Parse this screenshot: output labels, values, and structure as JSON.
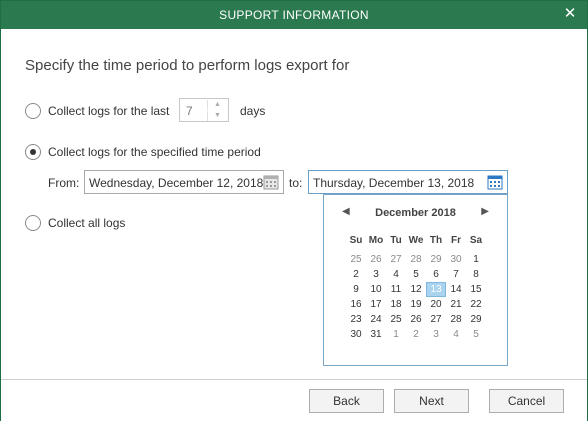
{
  "window": {
    "title": "SUPPORT INFORMATION",
    "close_glyph": "✕"
  },
  "heading": "Specify the time period to perform logs export for",
  "options": {
    "last_days": {
      "label": "Collect logs for the last",
      "value": "7",
      "unit": "days",
      "selected": false
    },
    "period": {
      "label": "Collect logs for the specified time period",
      "selected": true
    },
    "all": {
      "label": "Collect all logs",
      "selected": false
    }
  },
  "period": {
    "from_label": "From:",
    "from_value": "Wednesday, December 12, 2018",
    "to_label": "to:",
    "to_value": "Thursday, December 13, 2018"
  },
  "calendar": {
    "month": "December 2018",
    "prev": "◀",
    "next": "▶",
    "weekdays": [
      "Su",
      "Mo",
      "Tu",
      "We",
      "Th",
      "Fr",
      "Sa"
    ],
    "weeks": [
      [
        {
          "d": "25",
          "o": true
        },
        {
          "d": "26",
          "o": true
        },
        {
          "d": "27",
          "o": true
        },
        {
          "d": "28",
          "o": true
        },
        {
          "d": "29",
          "o": true
        },
        {
          "d": "30",
          "o": true
        },
        {
          "d": "1"
        }
      ],
      [
        {
          "d": "2"
        },
        {
          "d": "3"
        },
        {
          "d": "4"
        },
        {
          "d": "5"
        },
        {
          "d": "6"
        },
        {
          "d": "7"
        },
        {
          "d": "8"
        }
      ],
      [
        {
          "d": "9"
        },
        {
          "d": "10"
        },
        {
          "d": "11"
        },
        {
          "d": "12"
        },
        {
          "d": "13",
          "s": true
        },
        {
          "d": "14"
        },
        {
          "d": "15"
        }
      ],
      [
        {
          "d": "16"
        },
        {
          "d": "17"
        },
        {
          "d": "18"
        },
        {
          "d": "19"
        },
        {
          "d": "20"
        },
        {
          "d": "21"
        },
        {
          "d": "22"
        }
      ],
      [
        {
          "d": "23"
        },
        {
          "d": "24"
        },
        {
          "d": "25"
        },
        {
          "d": "26"
        },
        {
          "d": "27"
        },
        {
          "d": "28"
        },
        {
          "d": "29"
        }
      ],
      [
        {
          "d": "30"
        },
        {
          "d": "31"
        },
        {
          "d": "1",
          "o": true
        },
        {
          "d": "2",
          "o": true
        },
        {
          "d": "3",
          "o": true
        },
        {
          "d": "4",
          "o": true
        },
        {
          "d": "5",
          "o": true
        }
      ]
    ]
  },
  "buttons": {
    "back": "Back",
    "next": "Next",
    "cancel": "Cancel"
  },
  "colors": {
    "titlebar": "#2b7a4f",
    "selected_day": "#a9d3ee",
    "calendar_icon": "#2f78c4"
  }
}
